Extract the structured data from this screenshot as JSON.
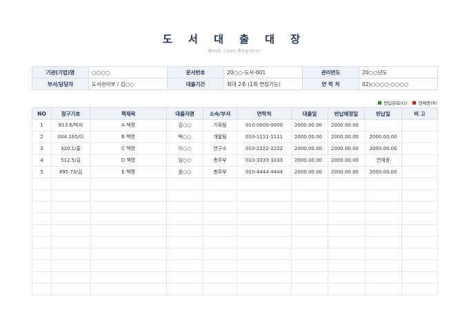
{
  "header": {
    "title": "도 서 대 출 대 장",
    "subtitle": "Book Loan Register"
  },
  "info": {
    "org_label": "기관(기업)명",
    "org_value": "○○○○",
    "doc_no_label": "문서번호",
    "doc_no_value": "20○○-도서-001",
    "year_label": "관리연도",
    "year_value": "20○○년도",
    "dept_label": "부서/담당자",
    "dept_value": "도서관리부 / 김○○",
    "period_label": "대출기간",
    "period_value": "최대 2주 (1회 연장가능)",
    "contact_label": "연 락 처",
    "contact_value": "02)○○○○-○○○○"
  },
  "legend": {
    "returned_label": "반납완료(G)",
    "returned_color": "#2e8b3a",
    "overdue_label": "연체중(R)",
    "overdue_color": "#c62828"
  },
  "table": {
    "headers": [
      "NO",
      "청구기호",
      "책제목",
      "대출자명",
      "소속/부서",
      "연락처",
      "대출일",
      "반납예정일",
      "반납일",
      "비 고"
    ],
    "rows": [
      {
        "no": "1",
        "call_no": "813.6/박지",
        "title": "A 책명",
        "borrower": "김○○",
        "dept": "기획팀",
        "phone": "010-0000-0000",
        "loan_date": "2000.00.00",
        "due_date": "2000.00.00",
        "return_date": "",
        "status": "",
        "note": ""
      },
      {
        "no": "2",
        "call_no": "004.165/이",
        "title": "B 책명",
        "borrower": "박○○",
        "dept": "개발팀",
        "phone": "010-1111-1111",
        "loan_date": "2000.00.00",
        "due_date": "2000.00.00",
        "return_date": "2000.00.00",
        "status": "returned",
        "note": ""
      },
      {
        "no": "3",
        "call_no": "320.1/홍",
        "title": "C 책명",
        "borrower": "이○○",
        "dept": "연구소",
        "phone": "010-2222-2222",
        "loan_date": "2000.00.00",
        "due_date": "2000.00.00",
        "return_date": "2000.00.00",
        "status": "returned",
        "note": ""
      },
      {
        "no": "4",
        "call_no": "512.5/김",
        "title": "D 책명",
        "borrower": "임○○",
        "dept": "총무부",
        "phone": "010-3333-3333",
        "loan_date": "2000.00.00",
        "due_date": "2000.00.00",
        "return_date": "연체중",
        "status": "overdue",
        "note": ""
      },
      {
        "no": "5",
        "call_no": "895.73/김",
        "title": "E 책명",
        "borrower": "윤○○",
        "dept": "총무부",
        "phone": "010-4444-4444",
        "loan_date": "2000.00.00",
        "due_date": "2000.00.00",
        "return_date": "2000.00.00",
        "status": "returned",
        "note": ""
      }
    ],
    "empty_rows": 10
  }
}
